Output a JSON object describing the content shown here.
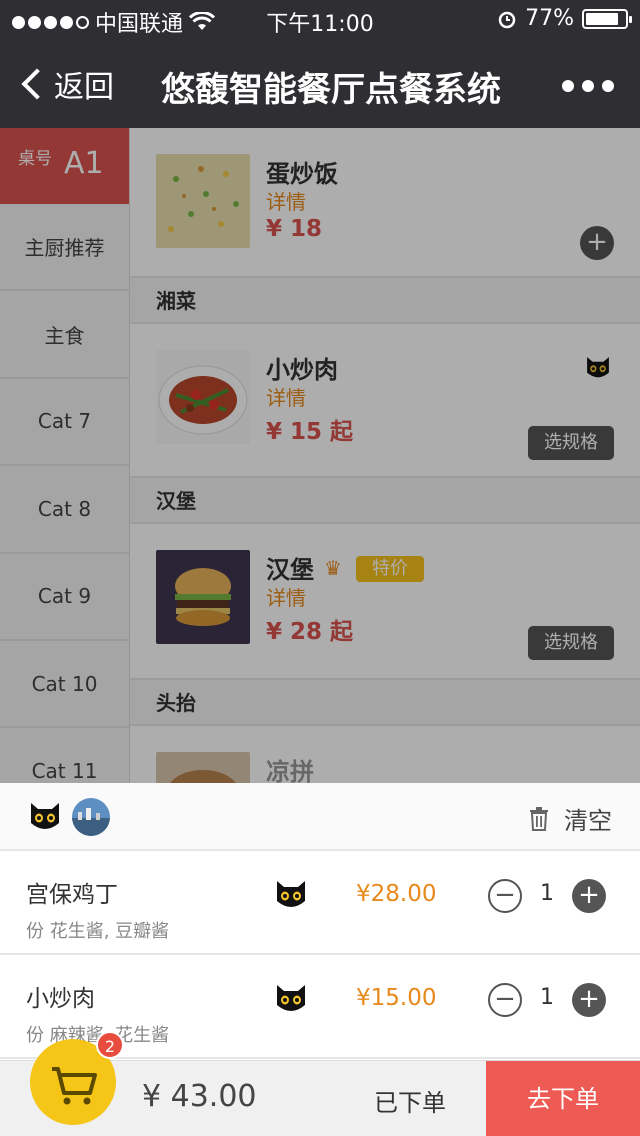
{
  "status_bar": {
    "carrier": "中国联通",
    "time": "下午11:00",
    "battery": "77%"
  },
  "nav": {
    "back_label": "返回",
    "title": "悠馥智能餐厅点餐系统"
  },
  "sidebar": {
    "table_label": "桌号",
    "table_value": "A1",
    "items": [
      {
        "label": "主厨推荐"
      },
      {
        "label": "主食"
      },
      {
        "label": "Cat 7"
      },
      {
        "label": "Cat 8"
      },
      {
        "label": "Cat 9"
      },
      {
        "label": "Cat 10"
      },
      {
        "label": "Cat 11"
      }
    ]
  },
  "menu": {
    "dish1": {
      "name": "蛋炒饭",
      "detail": "详情",
      "price": "¥ 18"
    },
    "section1": "湘菜",
    "dish2": {
      "name": "小炒肉",
      "detail": "详情",
      "price": "¥ 15 起",
      "spec": "选规格"
    },
    "section2": "汉堡",
    "dish3": {
      "name": "汉堡",
      "tag": "特价",
      "detail": "详情",
      "price": "¥ 28 起",
      "spec": "选规格"
    },
    "section3": "头抬",
    "dish4": {
      "name": "凉拼"
    }
  },
  "cart": {
    "clear_label": "清空",
    "items": [
      {
        "name": "宫保鸡丁",
        "sub": "份 花生酱, 豆瓣酱",
        "price": "¥28.00",
        "qty": "1"
      },
      {
        "name": "小炒肉",
        "sub": "份 麻辣酱, 花生酱",
        "price": "¥15.00",
        "qty": "1"
      }
    ]
  },
  "bottom": {
    "badge": "2",
    "total": "¥ 43.00",
    "ordered_label": "已下单",
    "checkout_label": "去下单"
  },
  "colors": {
    "accent_red": "#ee5b55",
    "accent_orange": "#e8891c",
    "cart_yellow": "#f5c518",
    "nav_dark": "#2e2e33"
  }
}
